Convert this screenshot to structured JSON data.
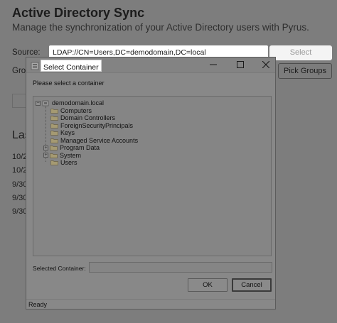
{
  "app": {
    "title": "Active Directory Sync",
    "subtitle": "Manage the synchronization of your Active Directory users with Pyrus.",
    "source_label": "Source:",
    "source_value": "LDAP://CN=Users,DC=demodomain,DC=local",
    "select_button": "Select",
    "groups_label": "Groups",
    "pick_groups_button": "Pick Groups",
    "last_label": "Last",
    "log_entries": [
      "10/2",
      "10/2",
      "9/30",
      "9/30",
      "9/30"
    ]
  },
  "dialog": {
    "title": "Select Container",
    "prompt": "Please select a container",
    "tree": {
      "root": "demodomain.local",
      "children": [
        {
          "label": "Computers",
          "expandable": false
        },
        {
          "label": "Domain Controllers",
          "expandable": false
        },
        {
          "label": "ForeignSecurityPrincipals",
          "expandable": false
        },
        {
          "label": "Keys",
          "expandable": false
        },
        {
          "label": "Managed Service Accounts",
          "expandable": false
        },
        {
          "label": "Program Data",
          "expandable": true
        },
        {
          "label": "System",
          "expandable": true
        },
        {
          "label": "Users",
          "expandable": false
        }
      ]
    },
    "selected_container_label": "Selected Container:",
    "selected_container_value": "",
    "ok_button": "OK",
    "cancel_button": "Cancel",
    "status": "Ready"
  }
}
